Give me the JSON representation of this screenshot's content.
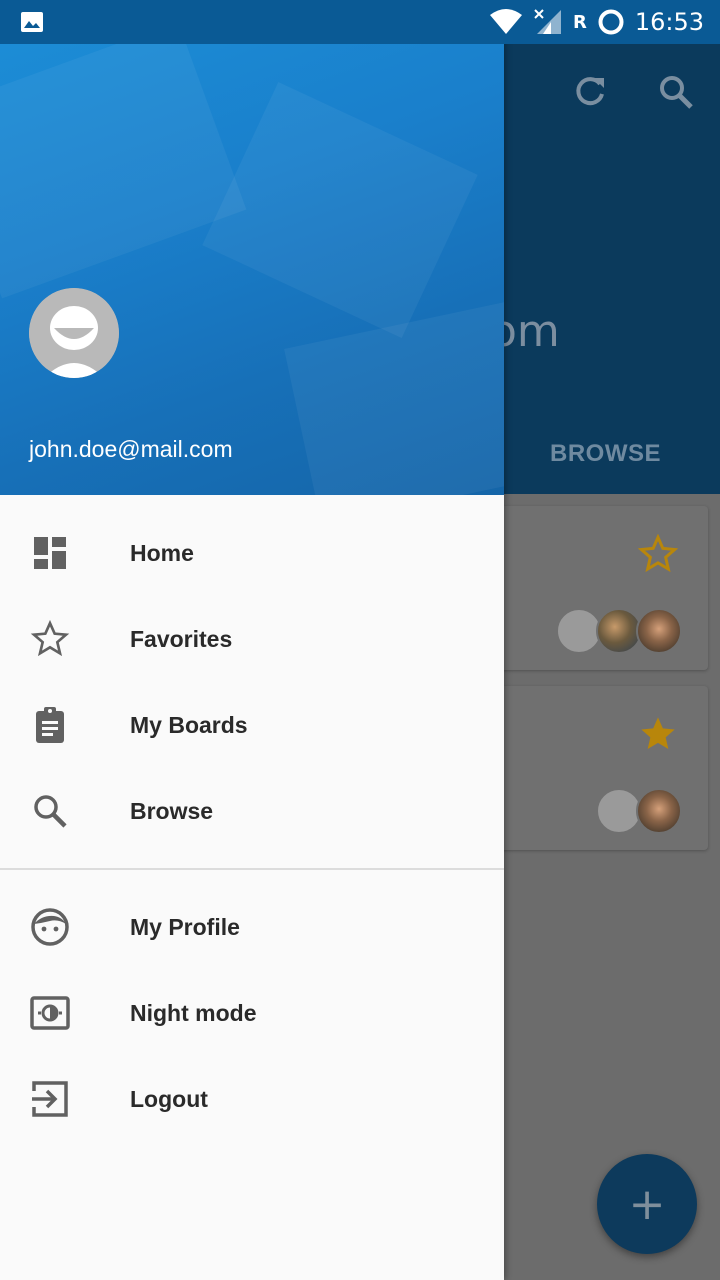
{
  "status_bar": {
    "time": "16:53",
    "roaming": "R"
  },
  "background_app": {
    "title_fragment": "om",
    "tab_browse": "BROWSE",
    "fab_symbol": "+"
  },
  "drawer": {
    "email": "john.doe@mail.com",
    "menu_primary": [
      {
        "label": "Home",
        "icon": "dashboard-icon"
      },
      {
        "label": "Favorites",
        "icon": "star-outline-icon"
      },
      {
        "label": "My Boards",
        "icon": "clipboard-icon"
      },
      {
        "label": "Browse",
        "icon": "search-icon"
      }
    ],
    "menu_secondary": [
      {
        "label": "My Profile",
        "icon": "face-icon"
      },
      {
        "label": "Night mode",
        "icon": "brightness-icon"
      },
      {
        "label": "Logout",
        "icon": "logout-icon"
      }
    ]
  },
  "colors": {
    "drawer_header": "#1a7fcb",
    "status_bar": "#0a5a95",
    "icon_gray": "#616161",
    "star_gold": "#b8860b"
  }
}
